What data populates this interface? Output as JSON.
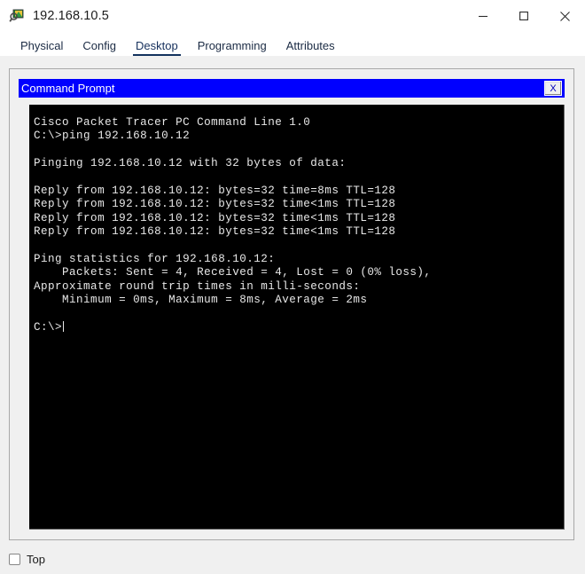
{
  "window": {
    "title": "192.168.10.5",
    "icon": "packet-tracer-icon",
    "controls": {
      "minimize": "—",
      "maximize": "□",
      "close": "✕"
    }
  },
  "tabs": [
    {
      "label": "Physical",
      "active": false
    },
    {
      "label": "Config",
      "active": false
    },
    {
      "label": "Desktop",
      "active": true
    },
    {
      "label": "Programming",
      "active": false
    },
    {
      "label": "Attributes",
      "active": false
    }
  ],
  "command_prompt": {
    "title": "Command Prompt",
    "close_label": "X",
    "title_bg": "#0000FF",
    "terminal_bg": "#000000",
    "terminal_fg": "#E8E8E8",
    "lines": [
      "Cisco Packet Tracer PC Command Line 1.0",
      "C:\\>ping 192.168.10.12",
      "",
      "Pinging 192.168.10.12 with 32 bytes of data:",
      "",
      "Reply from 192.168.10.12: bytes=32 time=8ms TTL=128",
      "Reply from 192.168.10.12: bytes=32 time<1ms TTL=128",
      "Reply from 192.168.10.12: bytes=32 time<1ms TTL=128",
      "Reply from 192.168.10.12: bytes=32 time<1ms TTL=128",
      "",
      "Ping statistics for 192.168.10.12:",
      "    Packets: Sent = 4, Received = 4, Lost = 0 (0% loss),",
      "Approximate round trip times in milli-seconds:",
      "    Minimum = 0ms, Maximum = 8ms, Average = 2ms",
      ""
    ],
    "prompt": "C:\\>"
  },
  "footer": {
    "top_checkbox_label": "Top",
    "top_checkbox_checked": false
  }
}
